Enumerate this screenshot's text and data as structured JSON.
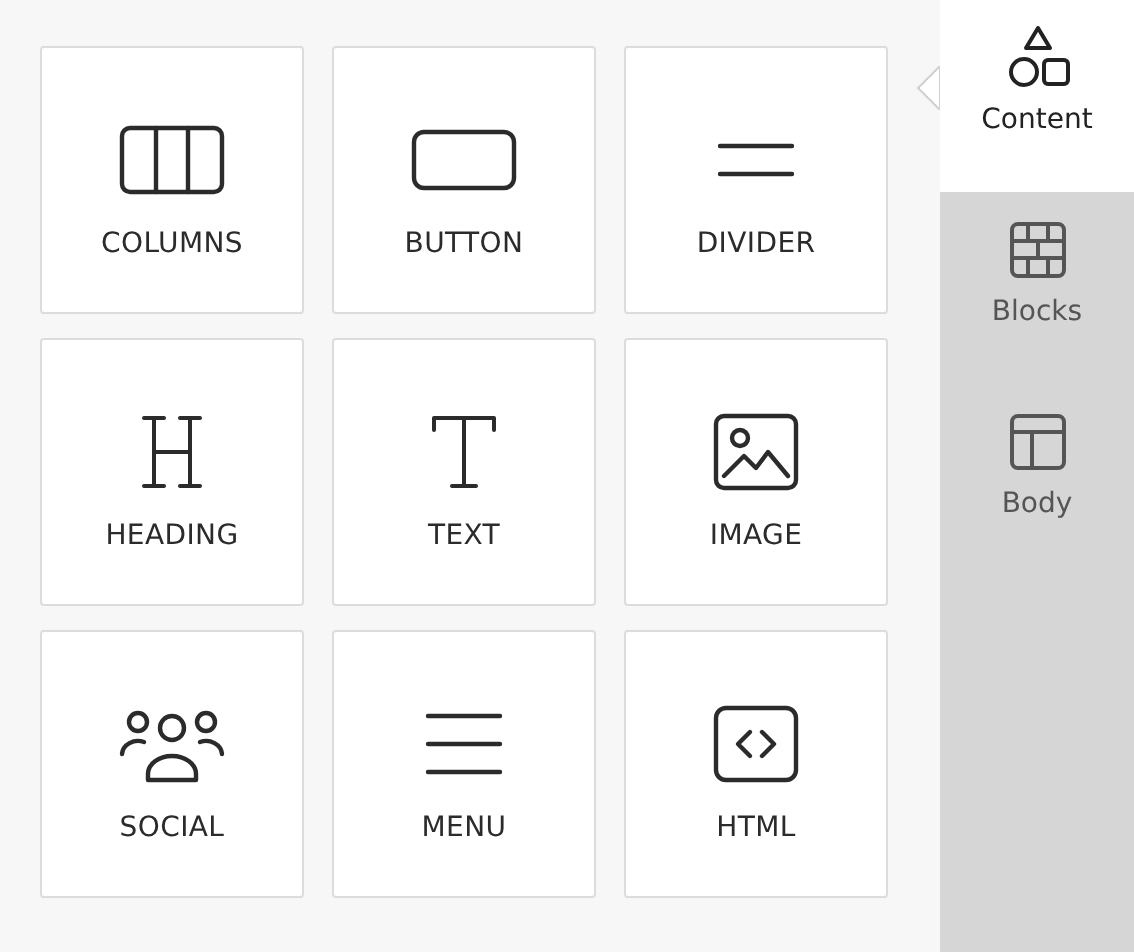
{
  "tiles": [
    {
      "kind": "columns",
      "label": "COLUMNS"
    },
    {
      "kind": "button",
      "label": "BUTTON"
    },
    {
      "kind": "divider",
      "label": "DIVIDER"
    },
    {
      "kind": "heading",
      "label": "HEADING"
    },
    {
      "kind": "text",
      "label": "TEXT"
    },
    {
      "kind": "image",
      "label": "IMAGE"
    },
    {
      "kind": "social",
      "label": "SOCIAL"
    },
    {
      "kind": "menu",
      "label": "MENU"
    },
    {
      "kind": "html",
      "label": "HTML"
    }
  ],
  "tabs": [
    {
      "kind": "content",
      "label": "Content",
      "selected": true
    },
    {
      "kind": "blocks",
      "label": "Blocks",
      "selected": false
    },
    {
      "kind": "body",
      "label": "Body",
      "selected": false
    }
  ]
}
